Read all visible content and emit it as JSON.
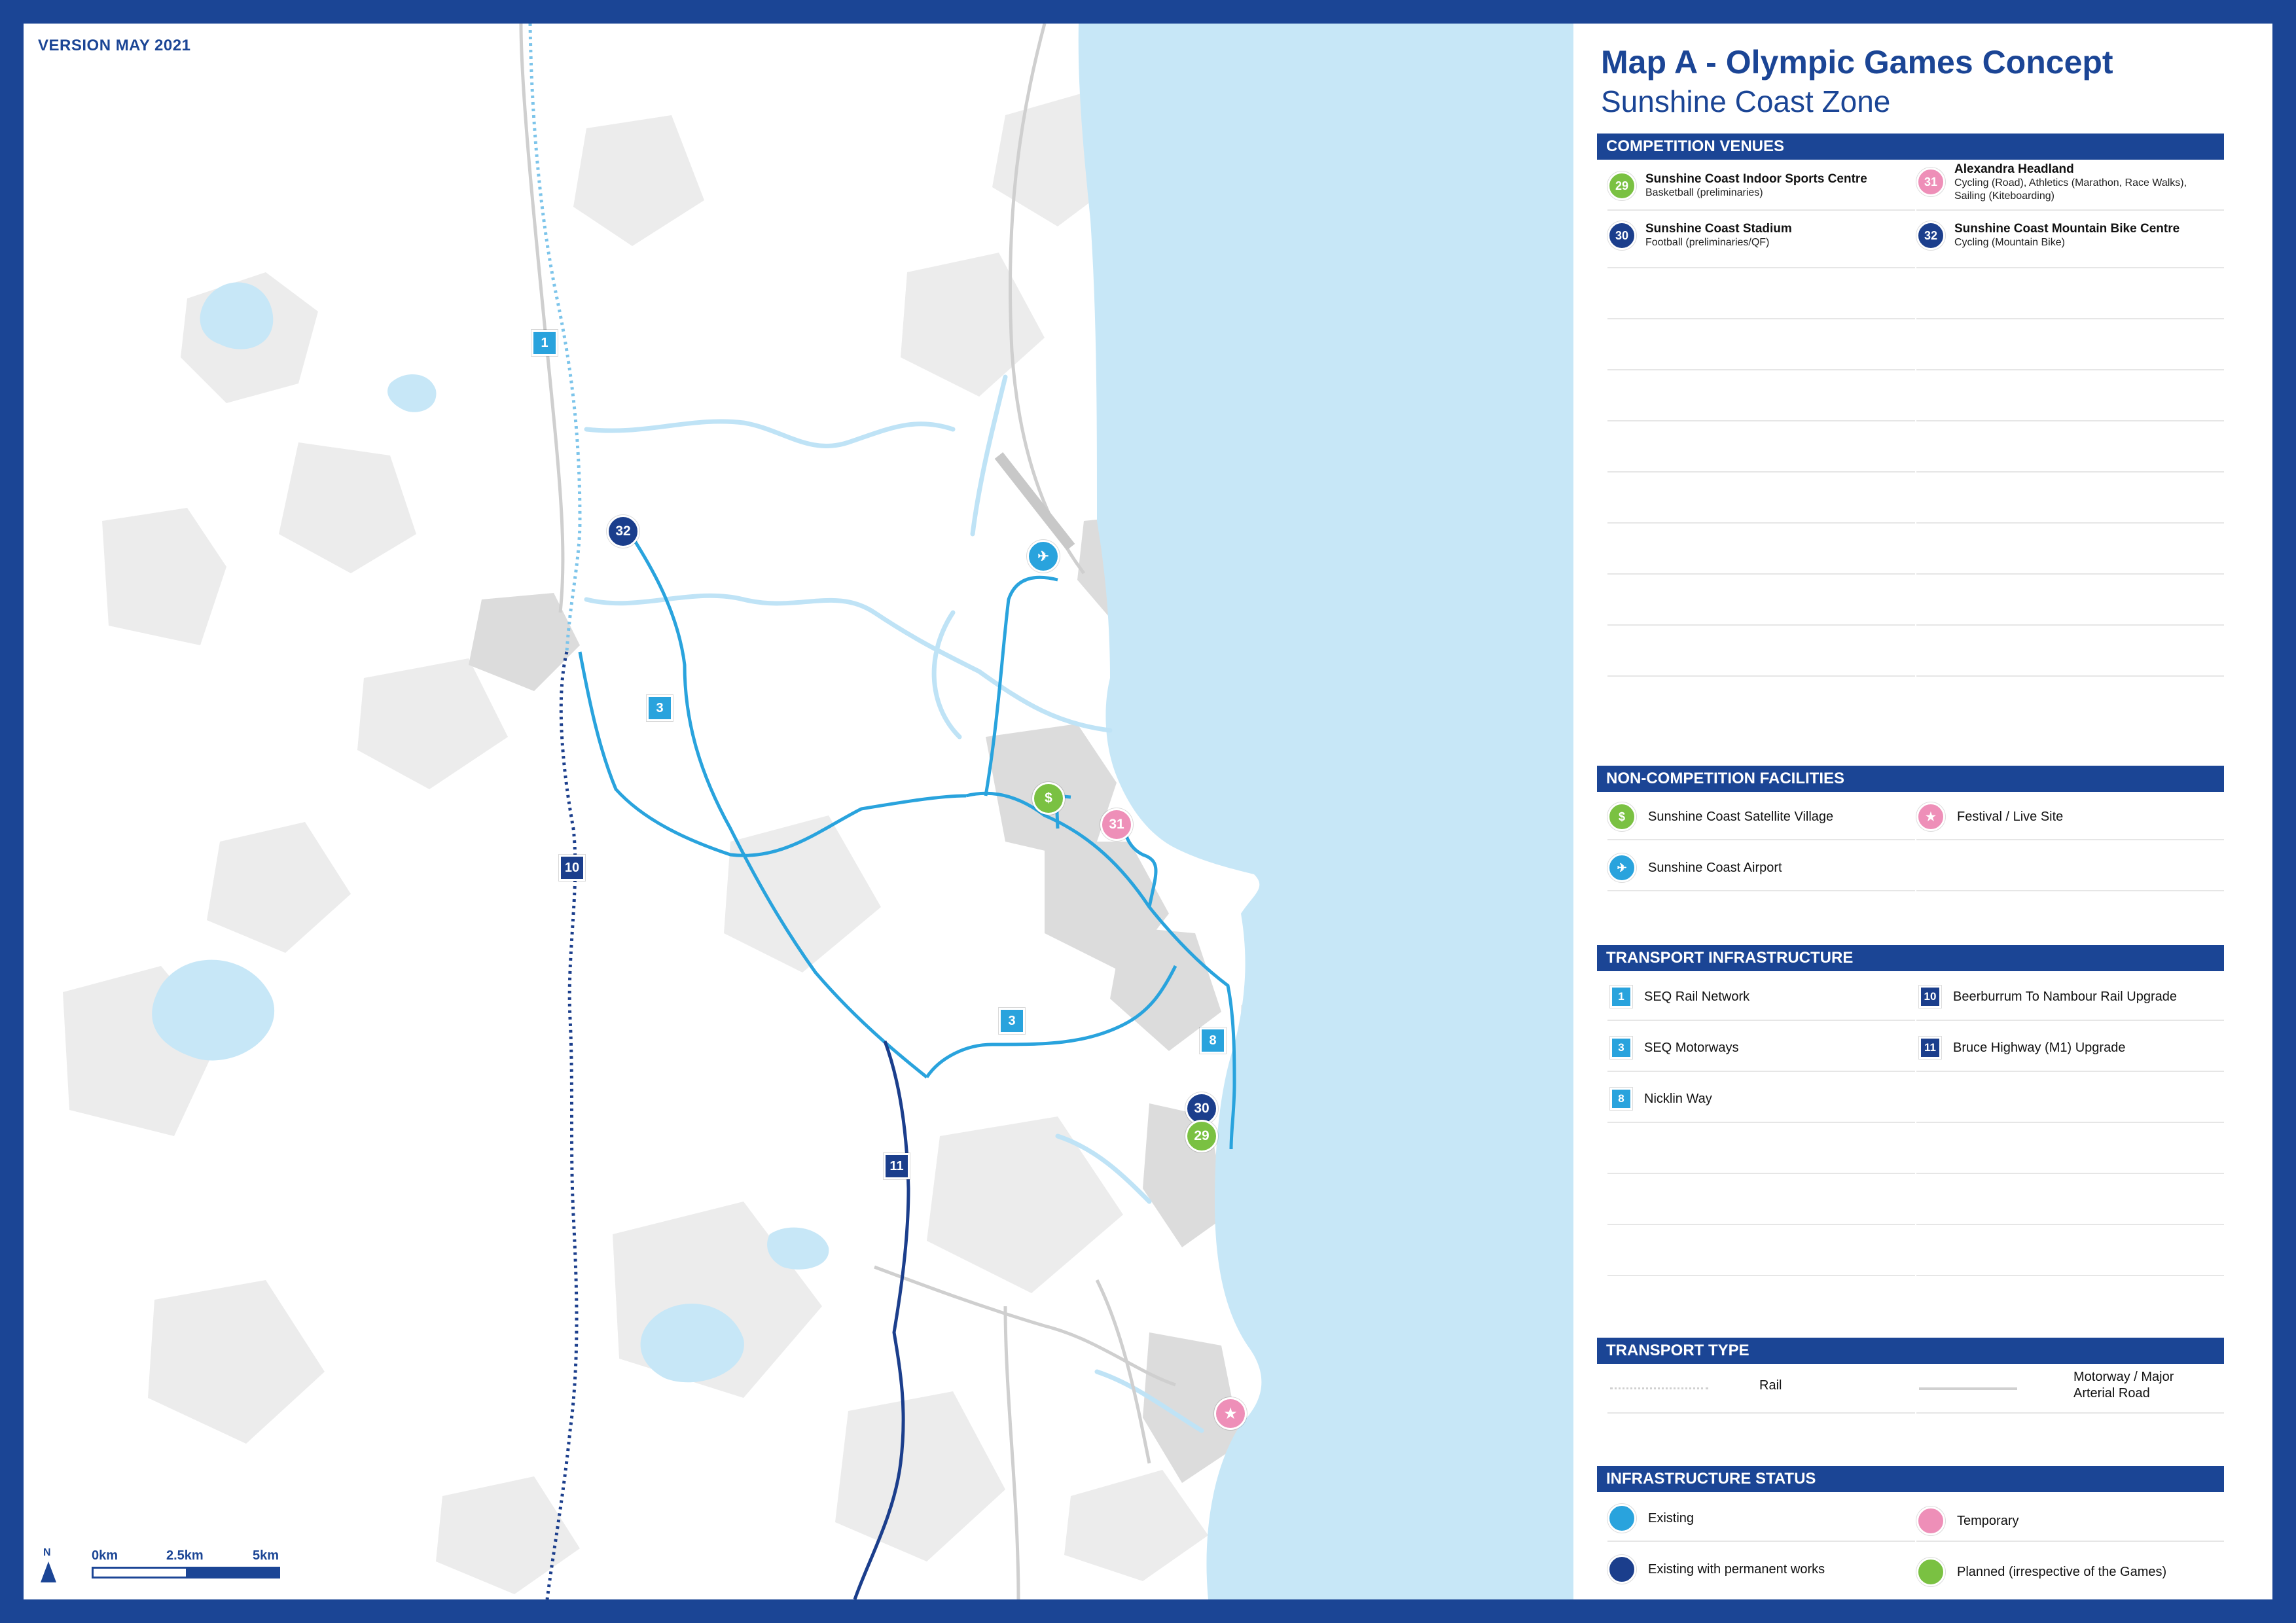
{
  "version_label": "VERSION MAY 2021",
  "title": "Map A - Olympic Games Concept",
  "subtitle": "Sunshine Coast Zone",
  "colors": {
    "brand_blue": "#1b4595",
    "existing": "#29a3dd",
    "existing_permanent": "#1b3e8c",
    "temporary": "#ee8fb8",
    "planned": "#7ac142",
    "ocean": "#c7e7f7"
  },
  "scale": {
    "north": "N",
    "ticks": [
      "0km",
      "2.5km",
      "5km"
    ]
  },
  "map_markers": {
    "venues": [
      {
        "label": "32",
        "color": "dark"
      },
      {
        "label": "31",
        "color": "pink"
      },
      {
        "label": "30",
        "color": "dark"
      },
      {
        "label": "29",
        "color": "green"
      }
    ],
    "routes": [
      {
        "label": "1",
        "color": "blue"
      },
      {
        "label": "3",
        "color": "blue"
      },
      {
        "label": "3",
        "color": "blue"
      },
      {
        "label": "8",
        "color": "blue"
      },
      {
        "label": "10",
        "color": "dark"
      },
      {
        "label": "11",
        "color": "dark"
      }
    ],
    "facilities": [
      {
        "icon": "village-icon",
        "glyph": "$",
        "color": "green"
      },
      {
        "icon": "airport-icon",
        "glyph": "✈",
        "color": "blue"
      },
      {
        "icon": "star-icon",
        "glyph": "★",
        "color": "pink"
      }
    ]
  },
  "sections": {
    "competition_venues": {
      "header": "COMPETITION VENUES",
      "items": [
        {
          "num": "29",
          "color": "green",
          "name": "Sunshine Coast Indoor Sports Centre",
          "desc": "Basketball (preliminaries)"
        },
        {
          "num": "31",
          "color": "pink",
          "name": "Alexandra Headland",
          "desc": "Cycling (Road), Athletics (Marathon, Race Walks),",
          "desc2": "Sailing (Kiteboarding)"
        },
        {
          "num": "30",
          "color": "dark",
          "name": "Sunshine Coast Stadium",
          "desc": "Football (preliminaries/QF)"
        },
        {
          "num": "32",
          "color": "dark",
          "name": "Sunshine Coast Mountain Bike Centre",
          "desc": "Cycling (Mountain Bike)"
        }
      ]
    },
    "non_competition": {
      "header": "NON-COMPETITION FACILITIES",
      "items": [
        {
          "icon": "village-icon",
          "glyph": "$",
          "color": "green",
          "label": "Sunshine Coast Satellite Village"
        },
        {
          "icon": "star-icon",
          "glyph": "★",
          "color": "pink",
          "label": "Festival / Live Site"
        },
        {
          "icon": "airport-icon",
          "glyph": "✈",
          "color": "blue",
          "label": "Sunshine Coast Airport"
        }
      ]
    },
    "transport_infrastructure": {
      "header": "TRANSPORT INFRASTRUCTURE",
      "items": [
        {
          "num": "1",
          "color": "blue",
          "label": "SEQ Rail Network"
        },
        {
          "num": "10",
          "color": "dark",
          "label": "Beerburrum To Nambour Rail Upgrade"
        },
        {
          "num": "3",
          "color": "blue",
          "label": "SEQ Motorways"
        },
        {
          "num": "11",
          "color": "dark",
          "label": "Bruce Highway (M1) Upgrade"
        },
        {
          "num": "8",
          "color": "blue",
          "label": "Nicklin Way"
        }
      ]
    },
    "transport_type": {
      "header": "TRANSPORT TYPE",
      "rail": "Rail",
      "road_line1": "Motorway / Major",
      "road_line2": "Arterial Road"
    },
    "infrastructure_status": {
      "header": "INFRASTRUCTURE STATUS",
      "items": [
        {
          "color": "blue",
          "label": "Existing"
        },
        {
          "color": "pink",
          "label": "Temporary"
        },
        {
          "color": "dark",
          "label": "Existing with permanent works"
        },
        {
          "color": "green",
          "label": "Planned (irrespective of the Games)"
        }
      ]
    }
  }
}
